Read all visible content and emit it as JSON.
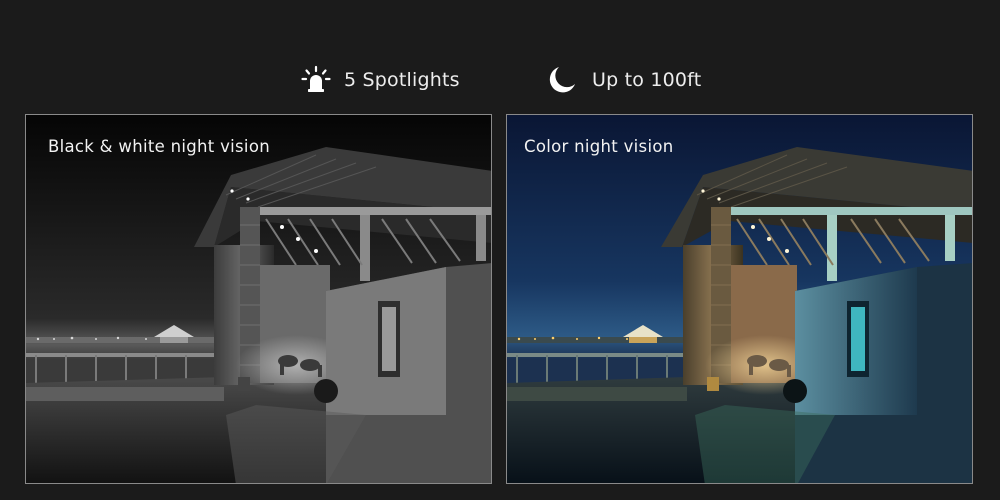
{
  "features": [
    {
      "icon": "spotlight-icon",
      "label": "5 Spotlights"
    },
    {
      "icon": "moon-icon",
      "label": "Up to 100ft"
    }
  ],
  "panels": [
    {
      "mode": "black-and-white",
      "label": "Black & white night vision"
    },
    {
      "mode": "color",
      "label": "Color night vision"
    }
  ],
  "colors": {
    "background": "#1b1b1b",
    "text": "#ededed",
    "panel_border": "#8a8a8a",
    "color_sky_top": "#0c1a3a",
    "color_sky_bottom": "#23466e"
  }
}
